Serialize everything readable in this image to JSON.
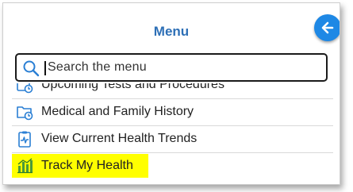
{
  "menu": {
    "title": "Menu"
  },
  "search": {
    "placeholder": "Search the menu"
  },
  "items": [
    {
      "label": "Upcoming Tests and Procedures",
      "icon": "calendar-clock-icon"
    },
    {
      "label": "Medical and Family History",
      "icon": "folder-clock-icon"
    },
    {
      "label": "View Current Health Trends",
      "icon": "clipboard-pulse-icon"
    },
    {
      "label": "Track My Health",
      "icon": "bar-chart-icon",
      "highlighted": true
    }
  ],
  "colors": {
    "accent": "#2d6fb6",
    "button": "#1e88e5",
    "icon": "#2a7fd4",
    "highlight": "#ffff00"
  }
}
